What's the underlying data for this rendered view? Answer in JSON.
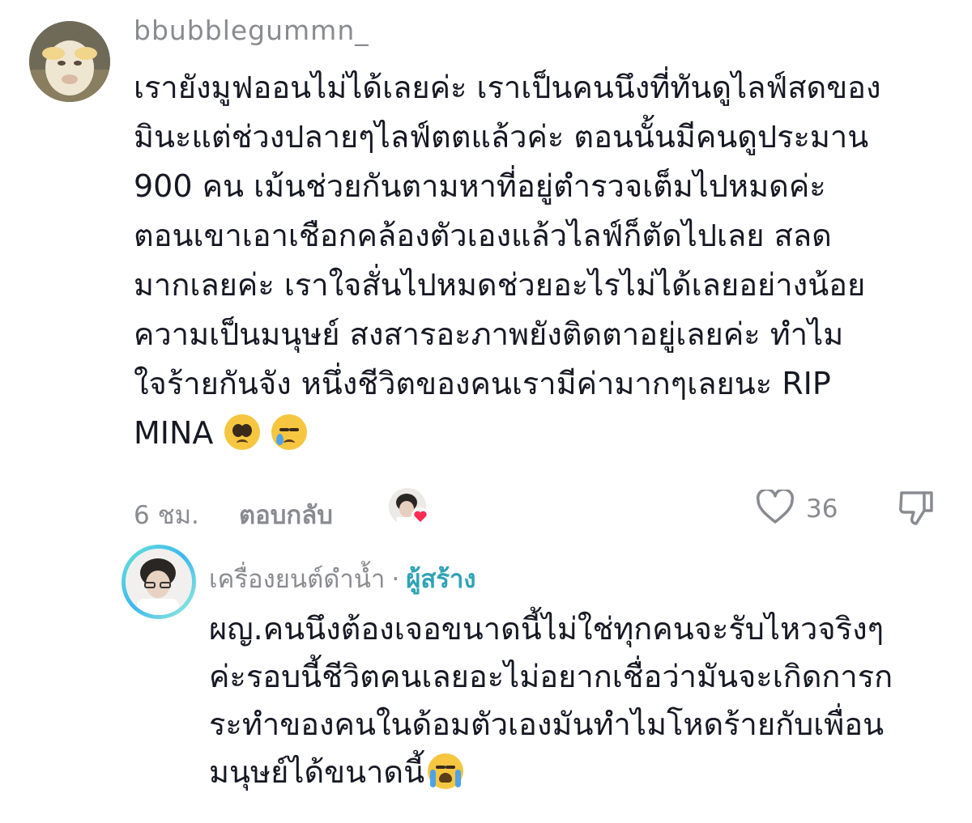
{
  "comment": {
    "username": "bbubblegummn_",
    "lines": [
      "เรายังมูฟออนไม่ได้เลยค่ะ เราเป็นคนนึงที่ทันดูไลฟ์สดของ",
      "มินะแต่ช่วงปลายๆไลฟ์ตตแล้วค่ะ ตอนนั้นมีคนดูประมาน",
      "900 คน เม้นช่วยกันตามหาที่อยู่ตำรวจเต็มไปหมดค่ะ",
      "ตอนเขาเอาเชือกคล้องตัวเองแล้วไลฟ์ก็ตัดไปเลย สลด",
      "มากเลยค่ะ เราใจสั่นไปหมดช่วยอะไรไม่ได้เลยอย่างน้อย",
      "ความเป็นมนุษย์ สงสารอะภาพยังติดตาอยู่เลยค่ะ ทำไม",
      "ใจร้ายกันจัง หนึ่งชีวิตของคนเรามีค่ามากๆเลยนะ RIP",
      "MINA"
    ],
    "emojis": [
      "pleading-face-icon",
      "crying-face-icon"
    ],
    "timestamp": "6 ชม.",
    "reply_label": "ตอบกลับ",
    "like_count": "36"
  },
  "reply": {
    "username": "เครื่องยนต์ดำน้ำ",
    "separator": "·",
    "creator_label": "ผู้สร้าง",
    "lines": [
      "ผญ.คนนึงต้องเจอขนาดนี้ไม่ใช่ทุกคนจะรับไหวจริงๆ",
      "ค่ะรอบนี้ชีวิตคนเลยอะไม่อยากเชื่อว่ามันจะเกิดการก",
      "ระทำของคนในด้อมตัวเองมันทำไมโหดร้ายกับเพื่อน",
      "มนุษย์ได้ขนาดนี้"
    ],
    "emoji": "loudly-crying-face-icon"
  },
  "colors": {
    "text": "#161823",
    "muted": "#8a8b91",
    "creator": "#2fa3b6",
    "heart": "#fe2c55"
  }
}
